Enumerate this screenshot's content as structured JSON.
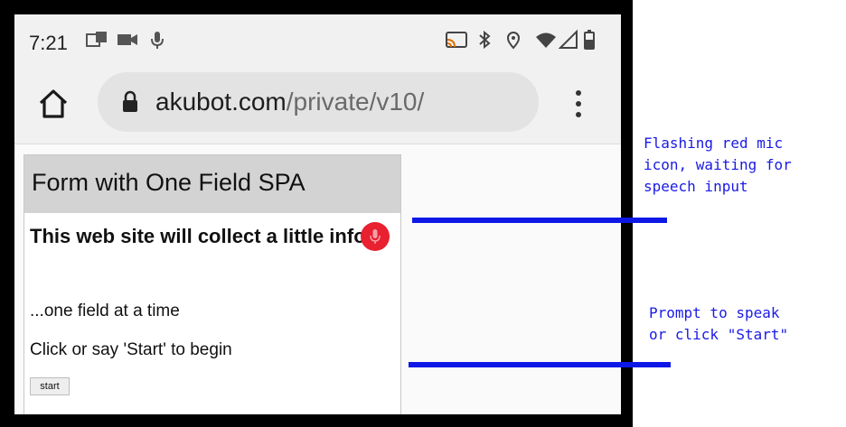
{
  "status_bar": {
    "time": "7:21",
    "icons": [
      "notification-icon",
      "video-camera-icon",
      "microphone-icon",
      "cast-icon",
      "bluetooth-icon",
      "location-icon",
      "wifi-icon",
      "signal-icon",
      "battery-icon"
    ]
  },
  "browser": {
    "url_host": "akubot.com",
    "url_path": "/private/v10/",
    "icons": [
      "home-icon",
      "lock-icon",
      "more-vert-icon"
    ]
  },
  "app": {
    "title": "Form with One Field SPA",
    "heading": "This web site will collect a little info...",
    "line1": "...one field at a time",
    "line2": "Click or say 'Start' to begin",
    "start_label": "start"
  },
  "annotations": {
    "mic": [
      "Flashing red mic",
      "icon, waiting for",
      "speech input"
    ],
    "prompt": [
      "Prompt to speak",
      "or click \"Start\""
    ]
  },
  "colors": {
    "mic_red": "#e8202f",
    "annotation_blue": "#1a1ae6",
    "header_gray": "#d3d3d3"
  }
}
